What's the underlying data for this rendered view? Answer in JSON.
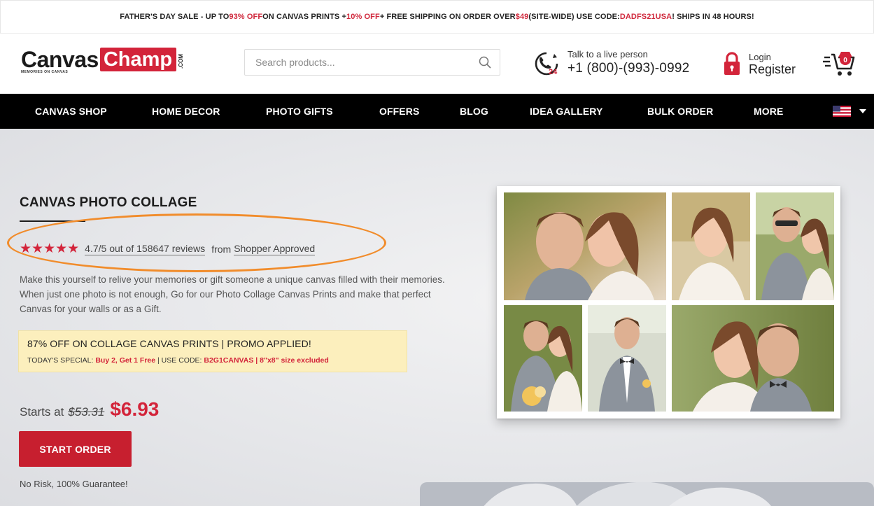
{
  "promo_bar": {
    "part1": "FATHER'S DAY SALE - UP TO ",
    "pct1": "93% OFF",
    "part2": " ON CANVAS PRINTS + ",
    "pct2": "10% OFF",
    "part3": " + FREE SHIPPING ON ORDER OVER ",
    "amount": "$49",
    "part4": " (SITE-WIDE) USE CODE: ",
    "code": "DADFS21USA",
    "part5": " ! SHIPS IN 48 HOURS!"
  },
  "header": {
    "logo_canvas": "Canvas",
    "logo_champ": "Champ",
    "logo_com": ".COM",
    "logo_tagline": "MEMORIES ON CANVAS",
    "search_placeholder": "Search products...",
    "phone_small": "Talk to a live person",
    "phone_number": "+1 (800)-(993)-0992",
    "login_label": "Login",
    "register_label": "Register",
    "cart_count": "0",
    "phone_badge": "24"
  },
  "nav": {
    "items": [
      "CANVAS SHOP",
      "HOME DECOR",
      "PHOTO GIFTS",
      "OFFERS",
      "BLOG",
      "IDEA GALLERY",
      "BULK ORDER",
      "MORE"
    ]
  },
  "hero": {
    "title": "CANVAS PHOTO COLLAGE",
    "stars": "★★★★★",
    "rating_text": "4.7/5 out of 158647 reviews",
    "rating_from": "from",
    "rating_source": "Shopper Approved",
    "description": "Make this yourself to relive your memories or gift someone a unique canvas filled with their memories. When just one photo is not enough, Go for our Photo Collage Canvas Prints and make that perfect Canvas for your walls or as a Gift.",
    "promo_line1": "87% OFF ON COLLAGE CANVAS PRINTS | PROMO APPLIED!",
    "promo_line2_prefix": "TODAY'S SPECIAL: ",
    "promo_line2_offer": "Buy 2, Get 1 Free",
    "promo_line2_mid": " | USE CODE: ",
    "promo_line2_code": "B2G1CANVAS | 8\"x8\" size excluded",
    "price_label": "Starts at",
    "price_old": "$53.31",
    "price_new": "$6.93",
    "cta": "START ORDER",
    "guarantee": "No Risk, 100% Guarantee!"
  },
  "colors": {
    "brand_red": "#d3243a",
    "highlight": "#f18c2b",
    "promo_box_bg": "#fcefbd",
    "nav_bg": "#000000"
  }
}
